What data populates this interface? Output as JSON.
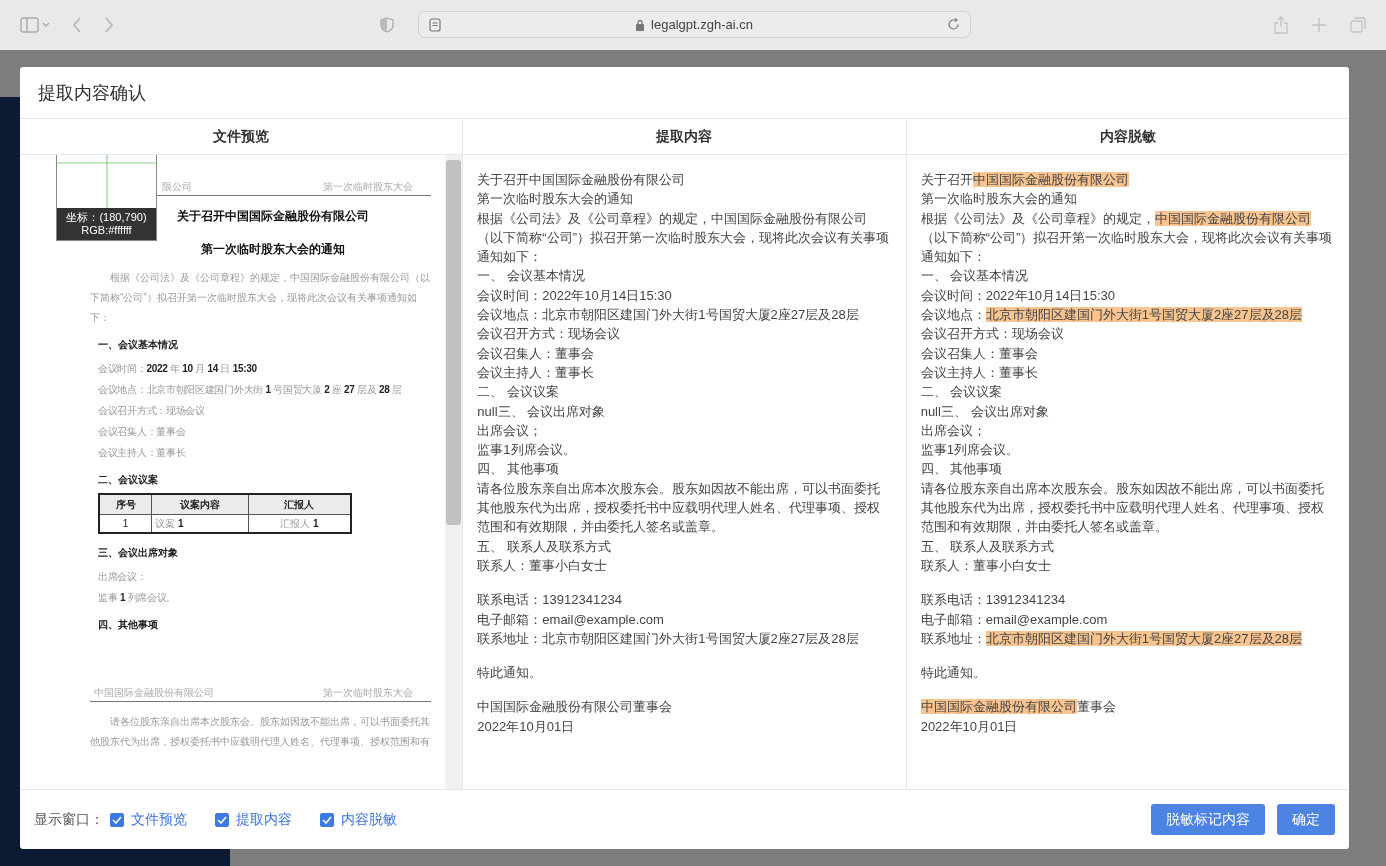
{
  "browser": {
    "url": "legalgpt.zgh-ai.cn"
  },
  "dialog": {
    "title": "提取内容确认",
    "columns": [
      {
        "title": "文件预览"
      },
      {
        "title": "提取内容"
      },
      {
        "title": "内容脱敏"
      }
    ],
    "preview": {
      "magnifier": {
        "coords": "坐标：(180,790)",
        "rgb": "RGB:#ffffff"
      },
      "pages": [
        {
          "head_left": "限公司",
          "head_right": "第一次临时股东大会",
          "blocks": [
            {
              "kind": "title",
              "text": "关于召开中国国际金融股份有限公司"
            },
            {
              "kind": "title",
              "text": "第一次临时股东大会的通知"
            },
            {
              "kind": "para",
              "text": "根据《公司法》及《公司章程》的规定，中国国际金融股份有限公司（以下简称“公司”）拟召开第一次临时股东大会，现将此次会议有关事项通知如下："
            },
            {
              "kind": "heading",
              "text": "一、会议基本情况"
            },
            {
              "kind": "field",
              "text": "会议时间：**2022** 年 **10** 月 **14** 日 **15:30**"
            },
            {
              "kind": "field",
              "text": "会议地点：北京市朝阳区建国门外大街 **1** 号国贸大厦 **2** 座 **27** 层及 **28** 层"
            },
            {
              "kind": "field",
              "text": "会议召开方式：现场会议"
            },
            {
              "kind": "field",
              "text": "会议召集人：董事会"
            },
            {
              "kind": "field",
              "text": "会议主持人：董事长"
            },
            {
              "kind": "heading",
              "text": "二、会议议案"
            },
            {
              "kind": "table",
              "columns": [
                "序号",
                "议案内容",
                "汇报人"
              ],
              "rows": [
                [
                  "1",
                  "议案 **1**",
                  "汇报人 **1**"
                ]
              ]
            },
            {
              "kind": "heading",
              "text": "三、会议出席对象"
            },
            {
              "kind": "field",
              "text": "出席会议："
            },
            {
              "kind": "field",
              "text": "监事 **1** 列席会议。"
            },
            {
              "kind": "heading",
              "text": "四、其他事项"
            }
          ]
        },
        {
          "head_left": "中国国际金融股份有限公司",
          "head_right": "第一次临时股东大会",
          "blocks": [
            {
              "kind": "para",
              "text": "请各位股东亲自出席本次股东会。股东如因故不能出席，可以书面委托其他股东代为出席，授权委托书中应载明代理人姓名、代理事项、授权范围和有"
            }
          ]
        }
      ]
    },
    "extracted": [
      {
        "text": "关于召开中国国际金融股份有限公司",
        "gap_before": false
      },
      {
        "text": "第一次临时股东大会的通知",
        "gap_before": false
      },
      {
        "text": "根据《公司法》及《公司章程》的规定，中国国际金融股份有限公司（以下简称“公司”）拟召开第一次临时股东大会，现将此次会议有关事项通知如下：",
        "gap_before": false
      },
      {
        "text": "一、 会议基本情况",
        "gap_before": false
      },
      {
        "text": "会议时间：2022年10月14日15:30",
        "gap_before": false
      },
      {
        "text": "会议地点：北京市朝阳区建国门外大街1号国贸大厦2座27层及28层",
        "gap_before": false
      },
      {
        "text": "会议召开方式：现场会议",
        "gap_before": false
      },
      {
        "text": "会议召集人：董事会",
        "gap_before": false
      },
      {
        "text": "会议主持人：董事长",
        "gap_before": false
      },
      {
        "text": "二、 会议议案",
        "gap_before": false
      },
      {
        "text": "null三、 会议出席对象",
        "gap_before": false
      },
      {
        "text": "出席会议；",
        "gap_before": false
      },
      {
        "text": "监事1列席会议。",
        "gap_before": false
      },
      {
        "text": "四、 其他事项",
        "gap_before": false
      },
      {
        "text": "请各位股东亲自出席本次股东会。股东如因故不能出席，可以书面委托其他股东代为出席，授权委托书中应载明代理人姓名、代理事项、授权范围和有效期限，并由委托人签名或盖章。",
        "gap_before": false
      },
      {
        "text": "五、 联系人及联系方式",
        "gap_before": false
      },
      {
        "text": "联系人：董事小白女士",
        "gap_before": false
      },
      {
        "text": "联系电话：13912341234",
        "gap_before": true
      },
      {
        "text": "电子邮箱：email@example.com",
        "gap_before": false
      },
      {
        "text": "联系地址：北京市朝阳区建国门外大街1号国贸大厦2座27层及28层",
        "gap_before": false
      },
      {
        "text": "特此通知。",
        "gap_before": true
      },
      {
        "text": "中国国际金融股份有限公司董事会",
        "gap_before": true
      },
      {
        "text": "2022年10月01日",
        "gap_before": false
      }
    ],
    "desensitized": [
      {
        "gap_before": false,
        "segments": [
          {
            "text": "关于召开",
            "masked": false
          },
          {
            "text": "中国国际金融股份有限公司",
            "masked": true
          }
        ]
      },
      {
        "gap_before": false,
        "segments": [
          {
            "text": "第一次临时股东大会的通知",
            "masked": false
          }
        ]
      },
      {
        "gap_before": false,
        "segments": [
          {
            "text": "根据《公司法》及《公司章程》的规定，",
            "masked": false
          },
          {
            "text": "中国国际金融股份有限公司",
            "masked": true
          },
          {
            "text": "（以下简称“公司”）拟召开第一次临时股东大会，现将此次会议有关事项通知如下：",
            "masked": false
          }
        ]
      },
      {
        "gap_before": false,
        "segments": [
          {
            "text": "一、 会议基本情况",
            "masked": false
          }
        ]
      },
      {
        "gap_before": false,
        "segments": [
          {
            "text": "会议时间：2022年10月14日15:30",
            "masked": false
          }
        ]
      },
      {
        "gap_before": false,
        "segments": [
          {
            "text": "会议地点：",
            "masked": false
          },
          {
            "text": "北京市朝阳区建国门外大街1号国贸大厦2座27层及28层",
            "masked": true
          }
        ]
      },
      {
        "gap_before": false,
        "segments": [
          {
            "text": "会议召开方式：现场会议",
            "masked": false
          }
        ]
      },
      {
        "gap_before": false,
        "segments": [
          {
            "text": "会议召集人：董事会",
            "masked": false
          }
        ]
      },
      {
        "gap_before": false,
        "segments": [
          {
            "text": "会议主持人：董事长",
            "masked": false
          }
        ]
      },
      {
        "gap_before": false,
        "segments": [
          {
            "text": "二、 会议议案",
            "masked": false
          }
        ]
      },
      {
        "gap_before": false,
        "segments": [
          {
            "text": "null三、 会议出席对象",
            "masked": false
          }
        ]
      },
      {
        "gap_before": false,
        "segments": [
          {
            "text": "出席会议；",
            "masked": false
          }
        ]
      },
      {
        "gap_before": false,
        "segments": [
          {
            "text": "监事1列席会议。",
            "masked": false
          }
        ]
      },
      {
        "gap_before": false,
        "segments": [
          {
            "text": "四、 其他事项",
            "masked": false
          }
        ]
      },
      {
        "gap_before": false,
        "segments": [
          {
            "text": "请各位股东亲自出席本次股东会。股东如因故不能出席，可以书面委托其他股东代为出席，授权委托书中应载明代理人姓名、代理事项、授权范围和有效期限，并由委托人签名或盖章。",
            "masked": false
          }
        ]
      },
      {
        "gap_before": false,
        "segments": [
          {
            "text": "五、 联系人及联系方式",
            "masked": false
          }
        ]
      },
      {
        "gap_before": false,
        "segments": [
          {
            "text": "联系人：董事小白女士",
            "masked": false
          }
        ]
      },
      {
        "gap_before": true,
        "segments": [
          {
            "text": "联系电话：13912341234",
            "masked": false
          }
        ]
      },
      {
        "gap_before": false,
        "segments": [
          {
            "text": "电子邮箱：email@example.com",
            "masked": false
          }
        ]
      },
      {
        "gap_before": false,
        "segments": [
          {
            "text": "联系地址：",
            "masked": false
          },
          {
            "text": "北京市朝阳区建国门外大街1号国贸大厦2座27层及28层",
            "masked": true
          }
        ]
      },
      {
        "gap_before": true,
        "segments": [
          {
            "text": "特此通知。",
            "masked": false
          }
        ]
      },
      {
        "gap_before": true,
        "segments": [
          {
            "text": "中国国际金融股份有限公司",
            "masked": true
          },
          {
            "text": "董事会",
            "masked": false
          }
        ]
      },
      {
        "gap_before": false,
        "segments": [
          {
            "text": "2022年10月01日",
            "masked": false
          }
        ]
      }
    ],
    "footer": {
      "label": "显示窗口：",
      "toggles": [
        {
          "label": "文件预览",
          "checked": true
        },
        {
          "label": "提取内容",
          "checked": true
        },
        {
          "label": "内容脱敏",
          "checked": true
        }
      ],
      "buttons": [
        "脱敏标记内容",
        "确定"
      ]
    }
  }
}
